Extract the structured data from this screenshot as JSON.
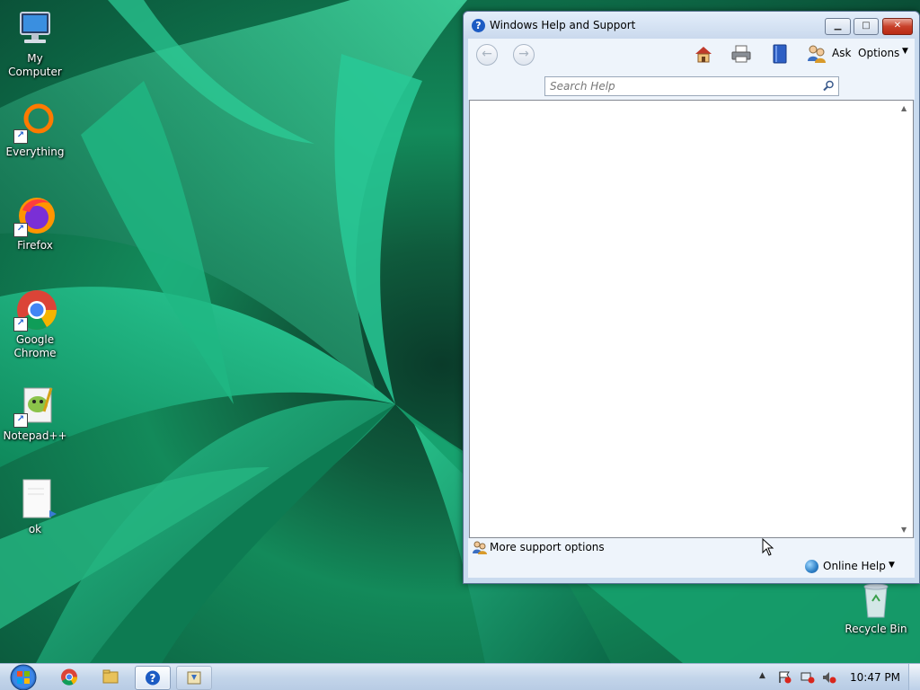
{
  "desktop": {
    "icons": [
      {
        "label": "My Computer"
      },
      {
        "label": "Everything"
      },
      {
        "label": "Firefox"
      },
      {
        "label": "Google Chrome"
      },
      {
        "label": "Notepad++"
      },
      {
        "label": "ok"
      },
      {
        "label": "Recycle Bin"
      }
    ]
  },
  "help_window": {
    "title": "Windows Help and Support",
    "title_buttons": {
      "minimize": "▁",
      "maximize": "□",
      "close": "✕"
    },
    "toolbar": {
      "back": "←",
      "forward": "→",
      "ask_label": "Ask",
      "options_label": "Options",
      "options_arrow": "▼"
    },
    "search": {
      "placeholder": "Search Help",
      "value": ""
    },
    "status": {
      "support_label": "More support options",
      "online_help_label": "Online Help",
      "online_help_arrow": "▼"
    },
    "scroll": {
      "up": "▲",
      "down": "▼"
    }
  },
  "taskbar": {
    "tray_arrow": "▲",
    "clock": "10:47 PM"
  },
  "colors": {
    "titlebar": "#cad9ed",
    "close_button": "#c8402a",
    "taskbar": "#c3d5ea"
  }
}
